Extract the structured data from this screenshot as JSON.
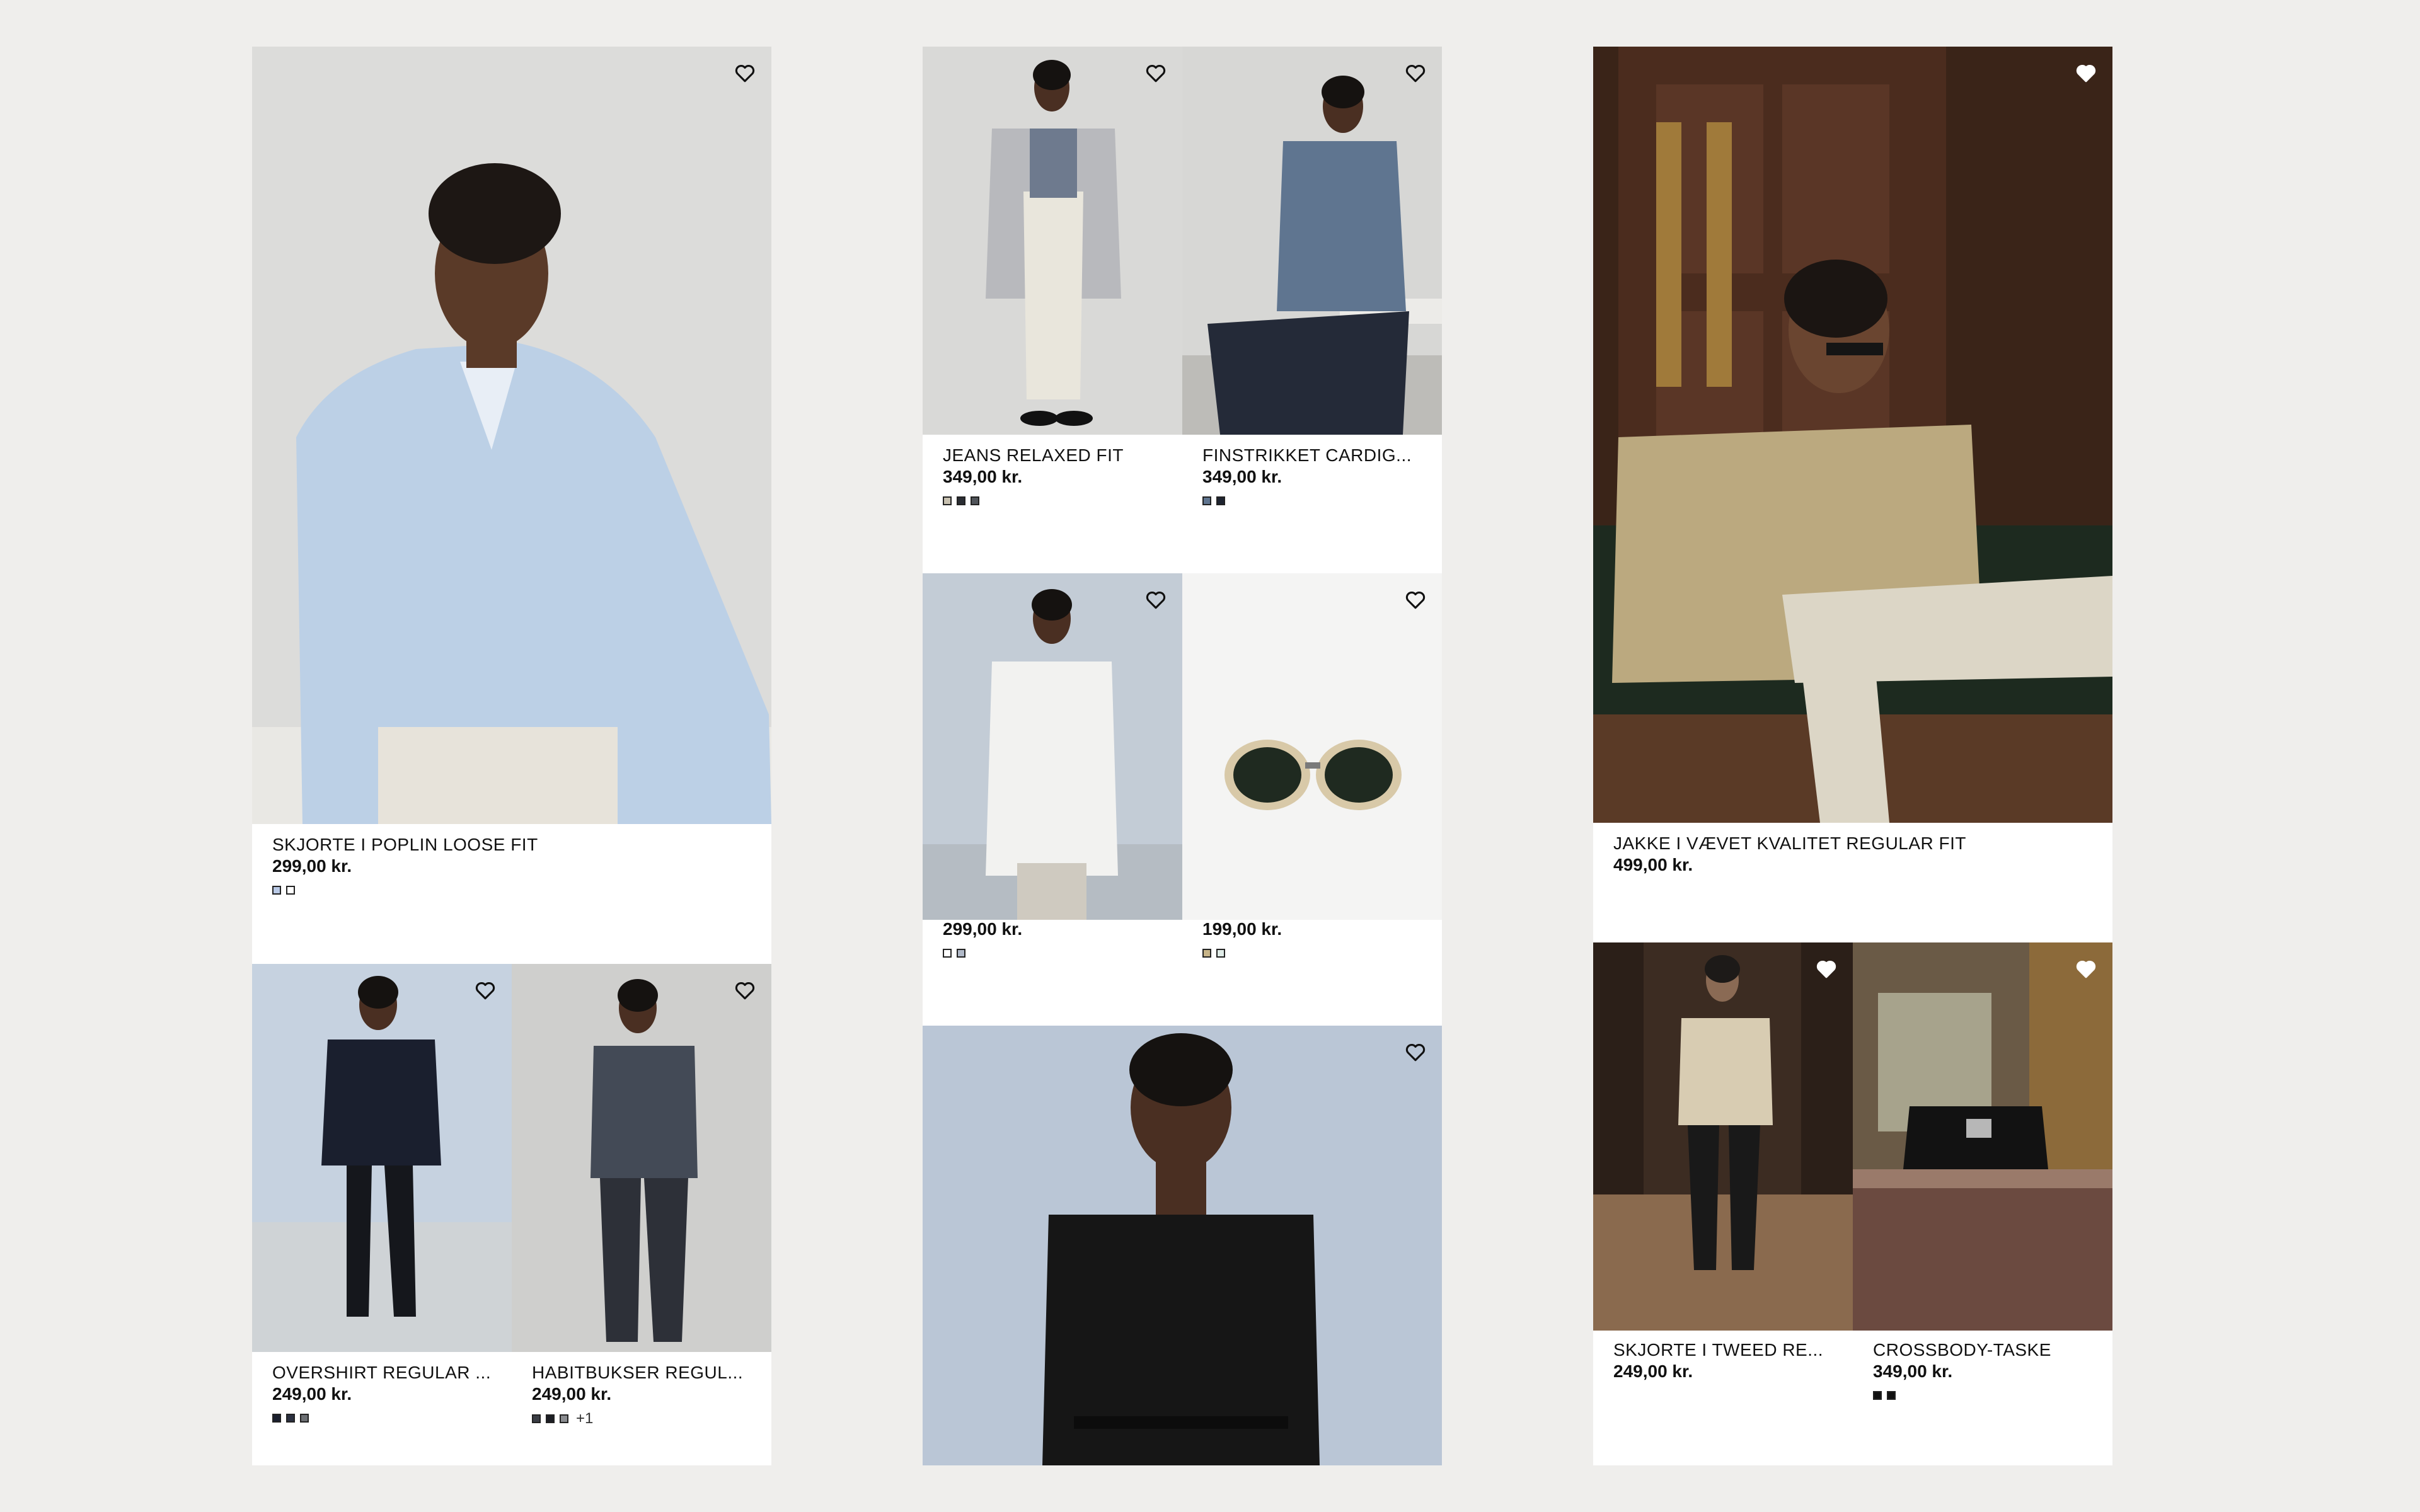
{
  "products": {
    "p1": {
      "name": "SKJORTE I POPLIN LOOSE FIT",
      "price": "299,00 kr.",
      "swatches": [
        "#b9c9e6",
        "#ffffff"
      ]
    },
    "p2": {
      "name": "OVERSHIRT REGULAR ...",
      "price": "249,00 kr.",
      "swatches": [
        "#1a1f2e",
        "#2b3040",
        "#6c6f73"
      ]
    },
    "p3": {
      "name": "HABITBUKSER REGUL...",
      "price": "249,00 kr.",
      "swatches": [
        "#3a3d44",
        "#1c1e24",
        "#8a8c90"
      ],
      "more": "+1"
    },
    "p4": {
      "name": "JEANS RELAXED FIT",
      "price": "349,00 kr.",
      "swatches": [
        "#c8c1b0",
        "#2a2d33",
        "#50545a"
      ]
    },
    "p5": {
      "name": "FINSTRIKKET CARDIG...",
      "price": "349,00 kr.",
      "swatches": [
        "#5f7590",
        "#1e2430"
      ]
    },
    "p6": {
      "name": "",
      "price": "299,00 kr.",
      "swatches": [
        "#ffffff",
        "#b0b9c8"
      ]
    },
    "p7": {
      "name": "",
      "price": "199,00 kr.",
      "swatches": [
        "#c7b488",
        "#e0ece8"
      ]
    },
    "p8": {
      "name": "JAKKE I VÆVET KVALITET REGULAR FIT",
      "price": "499,00 kr.",
      "swatches": []
    },
    "p9": {
      "name": "SKJORTE I TWEED RE...",
      "price": "249,00 kr.",
      "swatches": []
    },
    "p10": {
      "name": "CROSSBODY-TASKE",
      "price": "349,00 kr.",
      "swatches": [
        "#111111",
        "#111111"
      ]
    }
  },
  "icons": {
    "favorite": "heart-outline-icon"
  }
}
